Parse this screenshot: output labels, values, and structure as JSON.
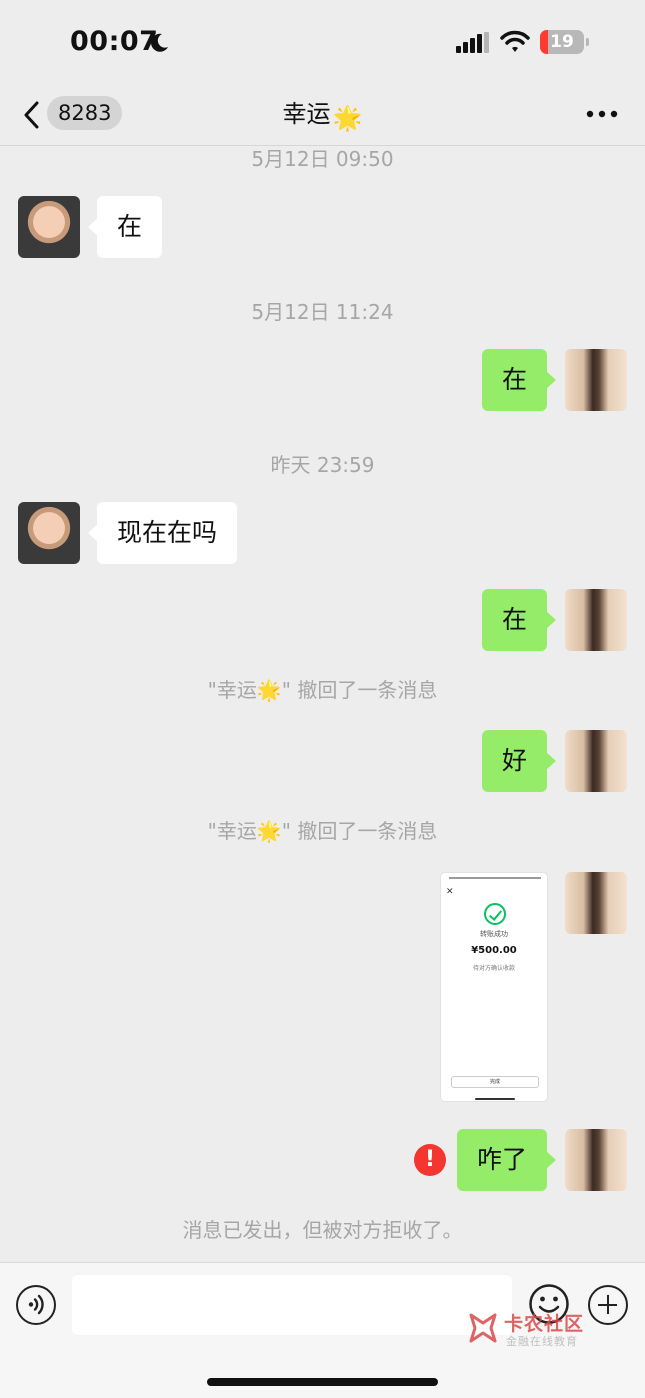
{
  "status_bar": {
    "time": "00:07",
    "battery_level": "19",
    "battery_fraction": 0.19
  },
  "nav": {
    "unread_count": "8283",
    "contact_name": "幸运",
    "contact_emoji": "🌟",
    "more_icon": "more-dots-icon",
    "back_icon": "chevron-left-icon"
  },
  "messages": {
    "ts1": "5月12日 09:50",
    "m1": "在",
    "ts2": "5月12日 11:24",
    "m2": "在",
    "ts3": "昨天 23:59",
    "m3": "现在在吗",
    "m4": "在",
    "recall1": "\"幸运🌟\" 撤回了一条消息",
    "m5": "好",
    "recall2": "\"幸运🌟\" 撤回了一条消息",
    "image": {
      "line1": "转账成功",
      "amount": "¥500.00",
      "line2": "待对方确认收款",
      "button": "完成"
    },
    "m6": "咋了",
    "error_mark": "!",
    "rejected_note": "消息已发出，但被对方拒收了。"
  },
  "input_bar": {
    "placeholder": "",
    "voice_icon": "voice-icon",
    "emoji_icon": "emoji-icon",
    "plus_icon": "plus-icon"
  },
  "watermark": {
    "title": "卡农社区",
    "subtitle": "金融在线教育"
  },
  "colors": {
    "background": "#ededed",
    "bubble_self": "#95ec69",
    "bubble_other": "#ffffff",
    "timestamp": "#a6a6a6",
    "error": "#f43530"
  }
}
